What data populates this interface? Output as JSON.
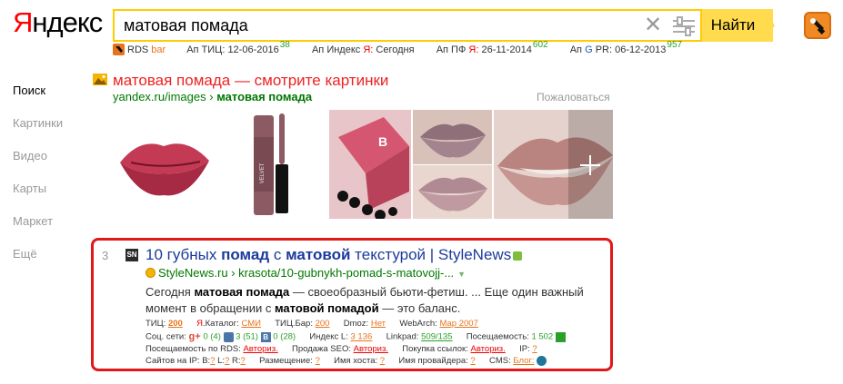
{
  "header": {
    "logo_first": "Я",
    "logo_rest": "ндекс",
    "search_value": "матовая помада",
    "find_label": "Найти"
  },
  "rds_bar": {
    "brand": "RDS",
    "brand_suffix": "bar",
    "tic_label": "Ап ТИЦ:",
    "tic_date": "12-06-2016",
    "tic_value": "38",
    "index_label": "Ап Индекс",
    "index_engine": "Я:",
    "index_value": "Сегодня",
    "pf_label": "Ап ПФ",
    "pf_engine": "Я:",
    "pf_date": "26-11-2014",
    "pf_value": "602",
    "pr_label": "Ап",
    "pr_engine": "G",
    "pr_label2": "PR:",
    "pr_date": "06-12-2013",
    "pr_value": "957"
  },
  "nav": {
    "items": [
      "Поиск",
      "Картинки",
      "Видео",
      "Карты",
      "Маркет",
      "Ещё"
    ]
  },
  "images_block": {
    "title": "матовая помада — смотрите картинки",
    "url_host": "yandex.ru/images",
    "url_sep": "›",
    "url_query": "матовая помада",
    "complain": "Пожаловаться"
  },
  "result": {
    "number": "3",
    "favicon_text": "SN",
    "title_parts": [
      "10 губных ",
      "помад",
      " с ",
      "матовой",
      " текстурой | StyleNews"
    ],
    "url_host": "StyleNews.ru",
    "url_sep": "›",
    "url_path": "krasota/10-gubnykh-pomad-s-matovojj-...",
    "url_arrow": "▼",
    "snippet_parts": [
      "Сегодня ",
      "матовая помада",
      " — своеобразный бьюти-фетиш. ... Еще один важный момент в обращении с ",
      "матовой помадой",
      " — это баланс."
    ]
  },
  "metrics": {
    "row1": {
      "tic_label": "ТИЦ:",
      "tic_value": "200",
      "cat_label_engine": "Я",
      "cat_label": ".Каталог:",
      "cat_value": "СМИ",
      "ticbar_label": "ТИЦ.Бар:",
      "ticbar_value": "200",
      "dmoz_label": "Dmoz:",
      "dmoz_value": "Нет",
      "webarchive_label": "WebArch:",
      "webarchive_value": "Мар 2007"
    },
    "row2": {
      "social_label": "Соц. сети:",
      "g_value": "0 (4)",
      "vk_value": "3 (51)",
      "b_value": "0 (28)",
      "index_label": "Индекс L:",
      "index_value": "3 136",
      "linkpad_label": "Linkpad:",
      "linkpad_value": "509/135",
      "visits_label": "Посещаемость:",
      "visits_value": "1 502"
    },
    "row3": {
      "rds_visits_label": "Посещаемость по RDS:",
      "rds_visits_value": "Авториз.",
      "seo_label": "Продажа SEO:",
      "seo_value": "Авториз.",
      "links_label": "Покупка ссылок:",
      "links_value": "Авториз.",
      "ip_label": "IP:",
      "ip_value": "?"
    },
    "row4": {
      "sites_label": "Сайтов на IP:",
      "b_label": "В:",
      "b_val": "?",
      "l_label": "L:",
      "l_val": "?",
      "r_label": "R:",
      "r_val": "?",
      "placement_label": "Размещение:",
      "placement_value": "?",
      "host_label": "Имя хоста:",
      "host_value": "?",
      "provider_label": "Имя провайдера:",
      "provider_value": "?",
      "cms_label": "CMS:",
      "cms_value": "Блог:"
    }
  },
  "colors": {
    "search_border": "#ffcc00",
    "find_button": "#ffdb4d",
    "image_title": "#ee2222",
    "result_link": "#1b3a9c",
    "url_green": "#007700",
    "highlight_frame": "#e01818",
    "metric_orange": "#e8731c"
  }
}
